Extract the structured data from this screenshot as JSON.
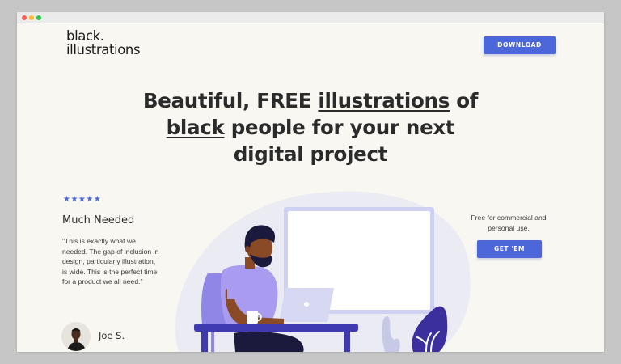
{
  "window": {
    "controls": [
      "close",
      "minimize",
      "maximize"
    ]
  },
  "header": {
    "logo_line1": "black.",
    "logo_line2": "illustrations",
    "download_label": "DOWNLOAD"
  },
  "hero": {
    "headline_part1": "Beautiful, FREE ",
    "headline_link1": "illustrations",
    "headline_part2": " of",
    "headline_link2": "black",
    "headline_part3": " people for your next",
    "headline_part4": "digital project"
  },
  "review": {
    "stars": "★★★★★",
    "rating": 5,
    "title": "Much Needed",
    "quote": "\"This is exactly what we needed. The gap of inclusion in design, particularly illustration, is wide. This is the perfect time for a product we all need.\"",
    "author": "Joe S."
  },
  "cta": {
    "text": "Free for commercial and personal use.",
    "button_label": "GET 'EM"
  },
  "colors": {
    "accent": "#4c67d9",
    "background": "#f9f7f2",
    "text": "#2b2b2b",
    "skin": "#8a4a25",
    "shirt": "#a99cf0",
    "desk": "#3f3ab0",
    "plant": "#3b2f9e"
  }
}
